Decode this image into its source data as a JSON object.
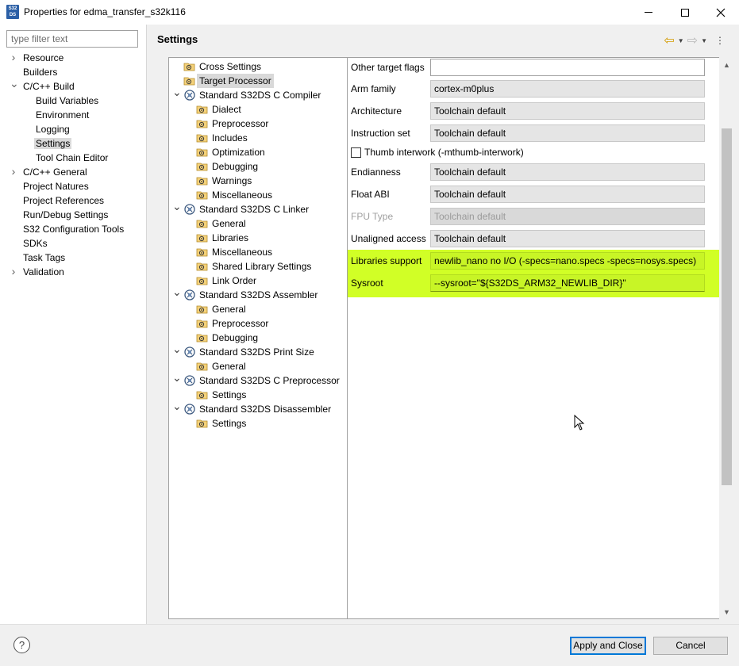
{
  "window": {
    "icon_text": "S32 DS",
    "title": "Properties for edma_transfer_s32k116"
  },
  "left": {
    "filter_placeholder": "type filter text",
    "items": [
      {
        "label": "Resource",
        "level": 0,
        "expander": "collapsed"
      },
      {
        "label": "Builders",
        "level": 0,
        "expander": "none"
      },
      {
        "label": "C/C++ Build",
        "level": 0,
        "expander": "expanded"
      },
      {
        "label": "Build Variables",
        "level": 1,
        "expander": "none"
      },
      {
        "label": "Environment",
        "level": 1,
        "expander": "none"
      },
      {
        "label": "Logging",
        "level": 1,
        "expander": "none"
      },
      {
        "label": "Settings",
        "level": 1,
        "expander": "none",
        "selected": true
      },
      {
        "label": "Tool Chain Editor",
        "level": 1,
        "expander": "none"
      },
      {
        "label": "C/C++ General",
        "level": 0,
        "expander": "collapsed"
      },
      {
        "label": "Project Natures",
        "level": 0,
        "expander": "none"
      },
      {
        "label": "Project References",
        "level": 0,
        "expander": "none"
      },
      {
        "label": "Run/Debug Settings",
        "level": 0,
        "expander": "none"
      },
      {
        "label": "S32 Configuration Tools",
        "level": 0,
        "expander": "none"
      },
      {
        "label": "SDKs",
        "level": 0,
        "expander": "none"
      },
      {
        "label": "Task Tags",
        "level": 0,
        "expander": "none"
      },
      {
        "label": "Validation",
        "level": 0,
        "expander": "collapsed"
      }
    ]
  },
  "header": {
    "title": "Settings"
  },
  "tool_tree": [
    {
      "label": "Cross Settings",
      "level": 0,
      "icon": "folder-settings-icon",
      "expander": "none"
    },
    {
      "label": "Target Processor",
      "level": 0,
      "icon": "folder-settings-icon",
      "expander": "none",
      "selected": true
    },
    {
      "label": "Standard S32DS C Compiler",
      "level": 0,
      "icon": "tool-gear-icon",
      "expander": "expanded"
    },
    {
      "label": "Dialect",
      "level": 1,
      "icon": "folder-settings-icon",
      "expander": "none"
    },
    {
      "label": "Preprocessor",
      "level": 1,
      "icon": "folder-settings-icon",
      "expander": "none"
    },
    {
      "label": "Includes",
      "level": 1,
      "icon": "folder-settings-icon",
      "expander": "none"
    },
    {
      "label": "Optimization",
      "level": 1,
      "icon": "folder-settings-icon",
      "expander": "none"
    },
    {
      "label": "Debugging",
      "level": 1,
      "icon": "folder-settings-icon",
      "expander": "none"
    },
    {
      "label": "Warnings",
      "level": 1,
      "icon": "folder-settings-icon",
      "expander": "none"
    },
    {
      "label": "Miscellaneous",
      "level": 1,
      "icon": "folder-settings-icon",
      "expander": "none"
    },
    {
      "label": "Standard S32DS C Linker",
      "level": 0,
      "icon": "tool-gear-icon",
      "expander": "expanded"
    },
    {
      "label": "General",
      "level": 1,
      "icon": "folder-settings-icon",
      "expander": "none"
    },
    {
      "label": "Libraries",
      "level": 1,
      "icon": "folder-settings-icon",
      "expander": "none"
    },
    {
      "label": "Miscellaneous",
      "level": 1,
      "icon": "folder-settings-icon",
      "expander": "none"
    },
    {
      "label": "Shared Library Settings",
      "level": 1,
      "icon": "folder-settings-icon",
      "expander": "none"
    },
    {
      "label": "Link Order",
      "level": 1,
      "icon": "folder-settings-icon",
      "expander": "none"
    },
    {
      "label": "Standard S32DS Assembler",
      "level": 0,
      "icon": "tool-gear-icon",
      "expander": "expanded"
    },
    {
      "label": "General",
      "level": 1,
      "icon": "folder-settings-icon",
      "expander": "none"
    },
    {
      "label": "Preprocessor",
      "level": 1,
      "icon": "folder-settings-icon",
      "expander": "none"
    },
    {
      "label": "Debugging",
      "level": 1,
      "icon": "folder-settings-icon",
      "expander": "none"
    },
    {
      "label": "Standard S32DS Print Size",
      "level": 0,
      "icon": "tool-gear-icon",
      "expander": "expanded"
    },
    {
      "label": "General",
      "level": 1,
      "icon": "folder-settings-icon",
      "expander": "none"
    },
    {
      "label": "Standard S32DS C Preprocessor",
      "level": 0,
      "icon": "tool-gear-icon",
      "expander": "expanded"
    },
    {
      "label": "Settings",
      "level": 1,
      "icon": "folder-settings-icon",
      "expander": "none"
    },
    {
      "label": "Standard S32DS Disassembler",
      "level": 0,
      "icon": "tool-gear-icon",
      "expander": "expanded"
    },
    {
      "label": "Settings",
      "level": 1,
      "icon": "folder-settings-icon",
      "expander": "none"
    }
  ],
  "props": {
    "other_target_flags": {
      "label": "Other target flags",
      "value": ""
    },
    "arm_family": {
      "label": "Arm family",
      "value": "cortex-m0plus"
    },
    "architecture": {
      "label": "Architecture",
      "value": "Toolchain default"
    },
    "instruction_set": {
      "label": "Instruction set",
      "value": "Toolchain default"
    },
    "thumb_interwork": {
      "label": "Thumb interwork (-mthumb-interwork)",
      "checked": false
    },
    "endianness": {
      "label": "Endianness",
      "value": "Toolchain default"
    },
    "float_abi": {
      "label": "Float ABI",
      "value": "Toolchain default"
    },
    "fpu_type": {
      "label": "FPU Type",
      "value": "Toolchain default",
      "disabled": true
    },
    "unaligned_access": {
      "label": "Unaligned access",
      "value": "Toolchain default"
    },
    "libraries_support": {
      "label": "Libraries support",
      "value": "newlib_nano no I/O (-specs=nano.specs -specs=nosys.specs)"
    },
    "sysroot": {
      "label": "Sysroot",
      "value": "--sysroot=\"${S32DS_ARM32_NEWLIB_DIR}\""
    },
    "highlight_color": "#c9ff00"
  },
  "buttons": {
    "help": "?",
    "apply_close": "Apply and Close",
    "cancel": "Cancel"
  }
}
